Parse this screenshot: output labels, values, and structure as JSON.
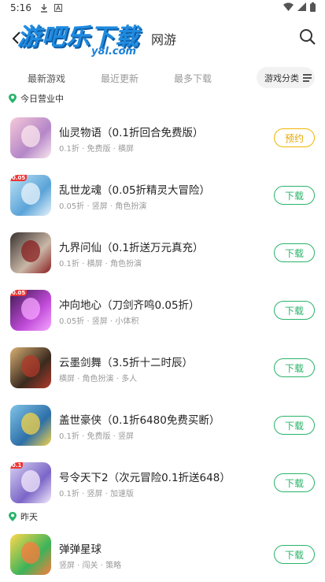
{
  "status_bar": {
    "time": "5:16"
  },
  "header": {
    "logo_main": "游吧乐下载",
    "logo_sub": "y8l.com",
    "title": "网游"
  },
  "tabs": [
    {
      "label": "最新游戏",
      "active": true
    },
    {
      "label": "最近更新",
      "active": false
    },
    {
      "label": "最多下载",
      "active": false
    }
  ],
  "category_button": "游戏分类",
  "sections": {
    "today": "今日营业中",
    "yesterday": "昨天"
  },
  "games": [
    {
      "name": "仙灵物语（0.1折回合免费版）",
      "meta": "0.1折 · 免费版 · 横屏",
      "button": "预约",
      "button_type": "reserve",
      "thumb_tag": "",
      "colors": [
        "#f6c9d9",
        "#b486c8",
        "#fbe7ee"
      ]
    },
    {
      "name": "乱世龙魂（0.05折精灵大冒险）",
      "meta": "0.05折 · 竖屏 · 角色扮演",
      "button": "下载",
      "button_type": "download",
      "thumb_tag": "0.05",
      "colors": [
        "#bfe3f5",
        "#5aa3d8",
        "#e9f4fb"
      ]
    },
    {
      "name": "九界问仙（0.1折送万元真充）",
      "meta": "0.1折 · 横屏 · 角色扮演",
      "button": "下载",
      "button_type": "download",
      "thumb_tag": "",
      "colors": [
        "#3a3230",
        "#c9b7a7",
        "#8a1f1f"
      ]
    },
    {
      "name": "冲向地心（刀剑齐鸣0.05折）",
      "meta": "0.05折 · 竖屏 · 小体积",
      "button": "下载",
      "button_type": "download",
      "thumb_tag": "0.05",
      "colors": [
        "#3d1a4f",
        "#c04ad8",
        "#f5a6ff"
      ]
    },
    {
      "name": "云墨剑舞（3.5折十二时辰）",
      "meta": "横屏 · 角色扮演 · 多人",
      "button": "下载",
      "button_type": "download",
      "thumb_tag": "",
      "colors": [
        "#d8b073",
        "#3b2a1f",
        "#b23a2a"
      ]
    },
    {
      "name": "盖世豪侠（0.1折6480免费买断）",
      "meta": "0.1折 · 免费版 · 竖屏",
      "button": "下载",
      "button_type": "download",
      "thumb_tag": "",
      "colors": [
        "#7fc4e8",
        "#2d6fa8",
        "#f3d34a"
      ]
    },
    {
      "name": "号令天下2（次元冒险0.1折送648）",
      "meta": "0.1折 · 竖屏 · 加速版",
      "button": "下载",
      "button_type": "download",
      "thumb_tag": "0.1",
      "colors": [
        "#d9d2f2",
        "#7b66c8",
        "#f4eafc"
      ]
    },
    {
      "name": "弹弹星球",
      "meta": "竖屏 · 闯关 · 策略",
      "button": "下载",
      "button_type": "download",
      "thumb_tag": "",
      "colors": [
        "#ffd84a",
        "#3cb35a",
        "#ff7a3c"
      ]
    }
  ],
  "accent_colors": {
    "green": "#2ab36a",
    "orange": "#e6a800",
    "blue": "#1f8be0"
  }
}
